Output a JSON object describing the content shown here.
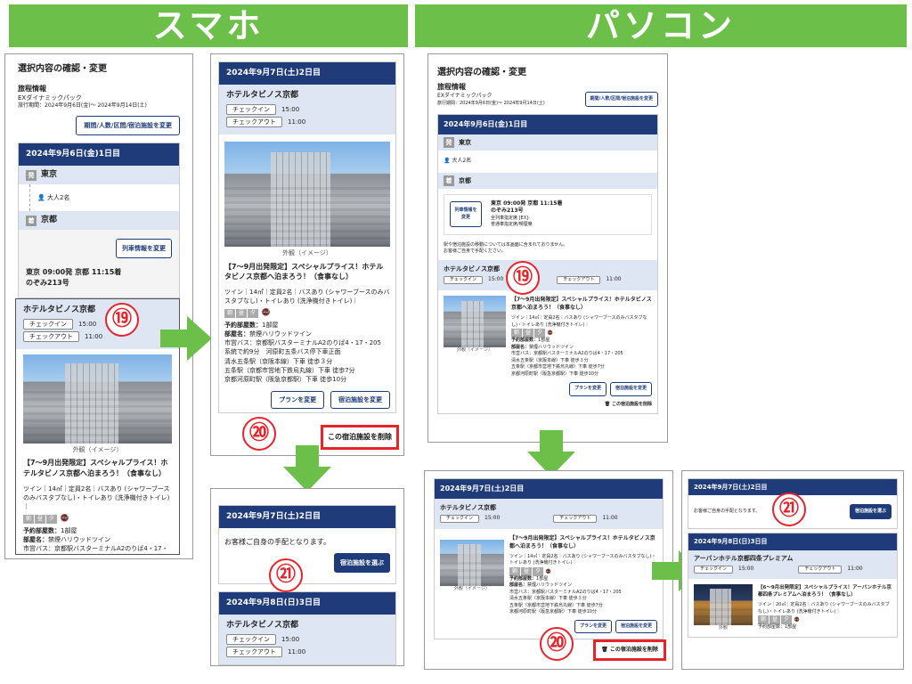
{
  "banners": {
    "phone": "スマホ",
    "pc": "パソコン"
  },
  "markers": {
    "m19": "⑲",
    "m20": "⑳",
    "m21": "㉑"
  },
  "confirm": {
    "title": "選択内容の確認・変更",
    "trip_info": "旅程情報",
    "product": "EXダイナミックパック",
    "period": "旅行期間：2024年9月6日(金)〜 2024年9月14日(土)",
    "change_btn": "期間/人数/区間/宿泊施設を変更"
  },
  "day1": {
    "header": "2024年9月6日(金)1日目",
    "from_badge": "発",
    "from": "東京",
    "pax": "大人2名",
    "to_badge": "着",
    "to": "京都",
    "train_btn": "列車情報を変更",
    "train_line1": "東京 09:00発  京都 11:15着",
    "train_line2": "のぞみ213号",
    "pc_train_btn": "列車情報を変更",
    "pc_train_time": "東京 09:00発 京都 11:15着",
    "pc_train_name": "のぞみ213号",
    "pc_train_seat": "全列車指定席 [EX]-",
    "pc_train_car": "普通車指定席/喫煙席",
    "notice1": "駅や宿泊施設の移動については本画面に含まれておりません。",
    "notice2": "お客様ご自身で手配ください。"
  },
  "hotel1": {
    "name": "ホテルタビノス京都",
    "checkin_label": "チェックイン",
    "checkin": "15:00",
    "checkout_label": "チェックアウト",
    "checkout": "11:00",
    "photo_caption": "外観（イメージ）",
    "plan_title": "【7〜9月出発限定】スペシャルプライス！ホテルタビノス京都へ泊まろう！（食事なし）",
    "room_desc": "ツイン｜14㎡｜定員2名｜バスあり (シャワーブースのみバスタブなし)・トイレあり (洗浄機付きトイレ)｜",
    "amenities": [
      "朝",
      "昼",
      "夕"
    ],
    "rooms_label": "予約部屋数：",
    "rooms": "1部屋",
    "roomtype_label": "部屋名：",
    "roomtype": "禁煙ハリウッドツイン",
    "access": [
      "市営バス：京都駅バスターミナルA2のりば4・17・205",
      "系統で約9分　河原町五条バス停下車正面",
      "清水五条駅（京阪本線）下車 徒歩３分",
      "五条駅（京都市営地下鉄烏丸線）下車 徒歩7分",
      "京都河原町駅（阪急京都駅）下車 徒歩10分"
    ],
    "plan_btn": "プランを変更",
    "hotel_btn": "宿泊施設を変更",
    "delete": "この宿泊施設を削除"
  },
  "day2": {
    "header": "2024年9月7日(土)2日目",
    "self_arrange": "お客様ご自身の手配となります。",
    "choose_btn": "宿泊施設を選ぶ"
  },
  "day3": {
    "header": "2024年9月8日(日)3日目",
    "hotel_name": "ホテルタビノス京都",
    "checkin_label": "チェックイン",
    "checkin": "15:00",
    "checkout_label": "チェックアウト",
    "checkout": "11:00",
    "pc_hotel_name": "アーバンホテル京都四条プレミアム",
    "pc_plan": "【6〜9月出発限定】スペシャルプライス！アーバンホテル京都四条プレミアムへ泊まろう！（食事なし）",
    "pc_room": "ツイン｜20㎡｜定員2名｜バスあり (シャワーブースのみバスタブなし)・トイレあり (洗浄機付きトイレ)｜",
    "pc_photo_caption": "外観",
    "pc_rooms": "予約部屋数：1部屋"
  },
  "colors": {
    "banner": "#6cc04a",
    "navy": "#1f3b7a",
    "light": "#dfe6f3",
    "red": "#e8232b",
    "arrow": "#6cc04a"
  }
}
